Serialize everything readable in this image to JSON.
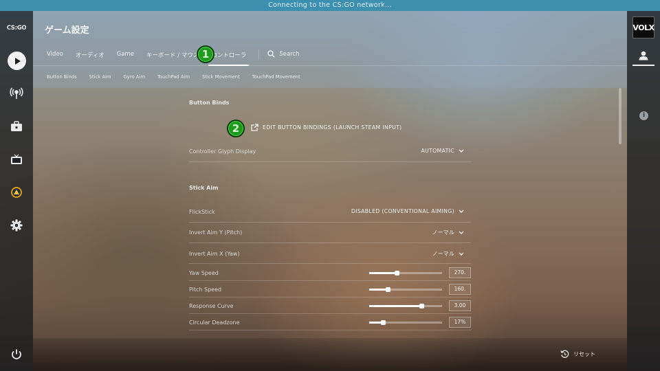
{
  "topbar": {
    "status": "Connecting to the CS:GO network..."
  },
  "leftnav": {
    "logo": "CS:GO",
    "items": [
      {
        "name": "play-icon"
      },
      {
        "name": "broadcast-icon"
      },
      {
        "name": "inventory-icon"
      },
      {
        "name": "tv-icon"
      },
      {
        "name": "profile-rank-icon"
      },
      {
        "name": "gear-icon"
      },
      {
        "name": "power-icon"
      }
    ]
  },
  "rightnav": {
    "avatar_label": "VOLX"
  },
  "header": {
    "title": "ゲーム設定",
    "tabs": [
      {
        "label": "Video"
      },
      {
        "label": "オーディオ"
      },
      {
        "label": "Game"
      },
      {
        "label": "キーボード / マウス"
      },
      {
        "label": "コントローラ"
      }
    ],
    "active_tab": "コントローラ",
    "search_label": "Search",
    "subtabs": [
      {
        "label": "Button Binds"
      },
      {
        "label": "Stick Aim"
      },
      {
        "label": "Gyro Aim"
      },
      {
        "label": "TouchPad Aim"
      },
      {
        "label": "Stick Movement"
      },
      {
        "label": "TouchPad Movement"
      }
    ]
  },
  "annotations": {
    "marker1": "1",
    "marker2": "2"
  },
  "button_binds": {
    "title": "Button Binds",
    "edit_label": "EDIT BUTTON BINDINGS (LAUNCH STEAM INPUT)",
    "glyph_label": "Controller Glyph Display",
    "glyph_value": "AUTOMATIC"
  },
  "stick_aim": {
    "title": "Stick Aim",
    "dropdowns": [
      {
        "label": "FlickStick",
        "value": "DISABLED (CONVENTIONAL AIMING)"
      },
      {
        "label": "Invert Aim Y (Pitch)",
        "value": "ノーマル"
      },
      {
        "label": "Invert Aim X (Yaw)",
        "value": "ノーマル"
      }
    ],
    "sliders": [
      {
        "label": "Yaw Speed",
        "value": "270.",
        "level": 0.38
      },
      {
        "label": "Pitch Speed",
        "value": "160.",
        "level": 0.25
      },
      {
        "label": "Response Curve",
        "value": "3.00",
        "level": 0.72
      },
      {
        "label": "Circular Deadzone",
        "value": "17%",
        "level": 0.19
      }
    ]
  },
  "footer": {
    "reset_label": "リセット"
  },
  "colors": {
    "topbar": "#3d8fb0",
    "marker": "#1f9a1f"
  }
}
